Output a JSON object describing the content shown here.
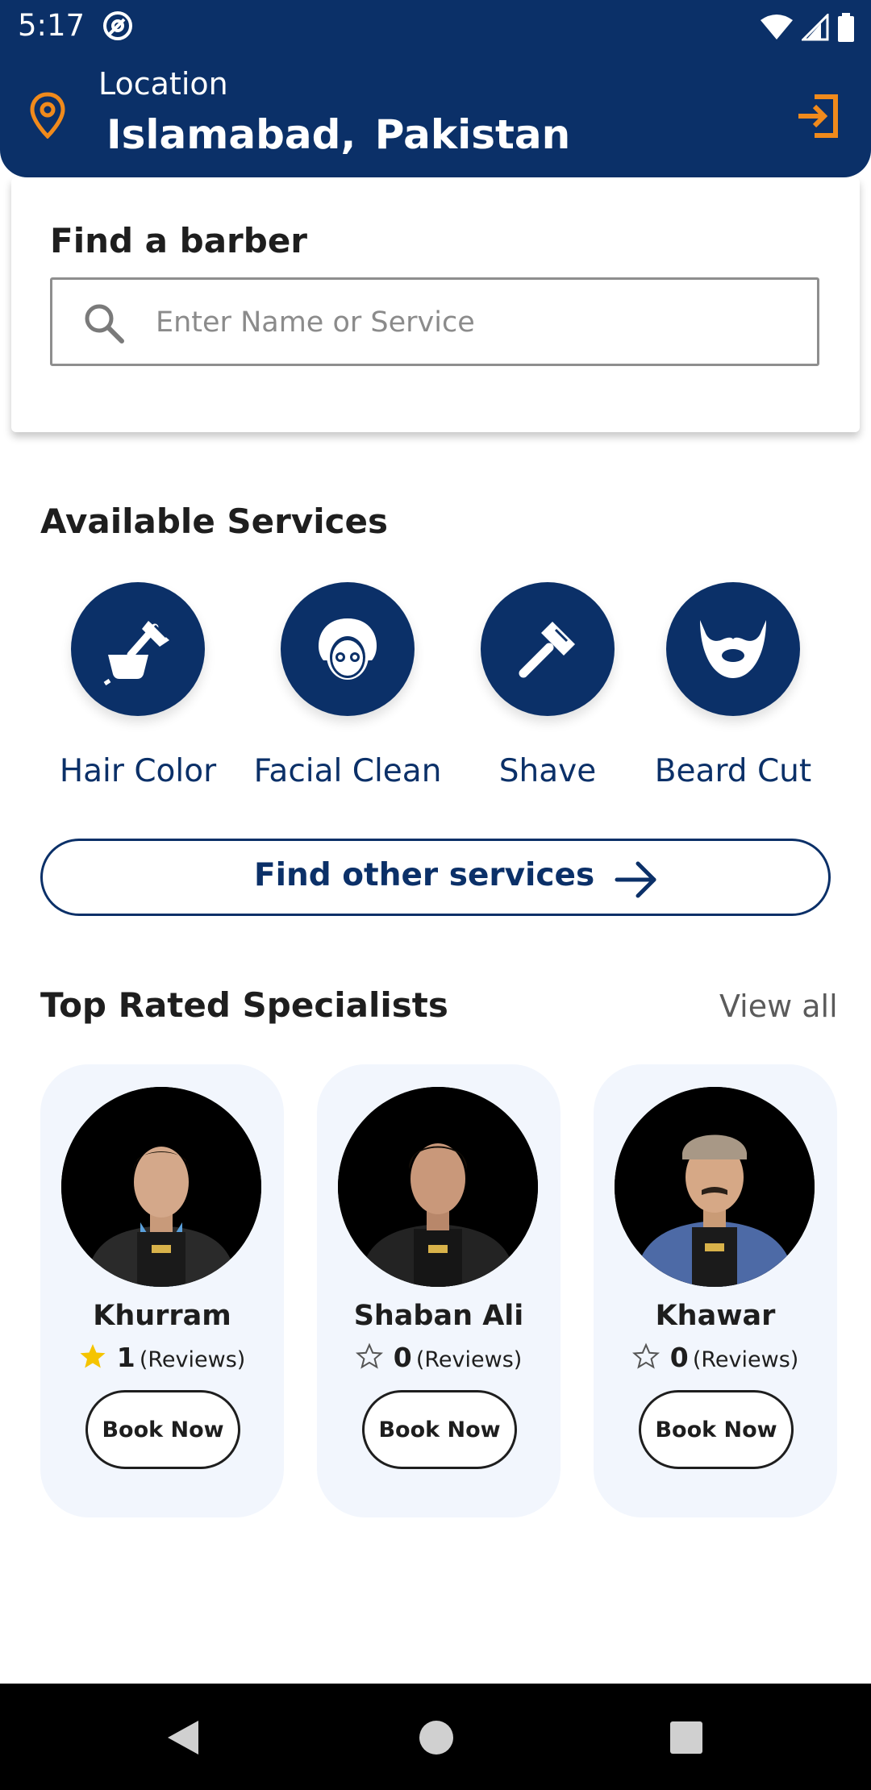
{
  "status_bar": {
    "time": "5:17",
    "app_icon": "at-sign-icon",
    "icons": [
      "wifi-icon",
      "signal-icon",
      "battery-icon"
    ]
  },
  "header": {
    "location_label": "Location",
    "location_value": "Islamabad,  Pakistan",
    "accent_color": "#f08a1c",
    "background_color": "#0b3068",
    "logout_icon": "login-icon"
  },
  "search": {
    "title": "Find a barber",
    "placeholder": "Enter Name or Service",
    "value": ""
  },
  "services": {
    "title": "Available Services",
    "items": [
      {
        "label": "Hair Color",
        "icon": "hair-dye-brush-icon"
      },
      {
        "label": "Facial Clean",
        "icon": "facial-mask-icon"
      },
      {
        "label": "Shave",
        "icon": "razor-icon"
      },
      {
        "label": "Beard Cut",
        "icon": "beard-icon"
      }
    ],
    "other_button": "Find other services"
  },
  "specialists": {
    "title": "Top Rated Specialists",
    "view_all": "View all",
    "items": [
      {
        "name": "Khurram",
        "rating": "1",
        "reviews": "(Reviews)",
        "star": "filled",
        "book": "Book Now"
      },
      {
        "name": "Shaban Ali",
        "rating": "0",
        "reviews": "(Reviews)",
        "star": "empty",
        "book": "Book Now"
      },
      {
        "name": "Khawar",
        "rating": "0",
        "reviews": "(Reviews)",
        "star": "empty",
        "book": "Book Now"
      }
    ]
  },
  "navbar": {
    "items": [
      "back-icon",
      "home-icon",
      "recents-icon"
    ]
  }
}
